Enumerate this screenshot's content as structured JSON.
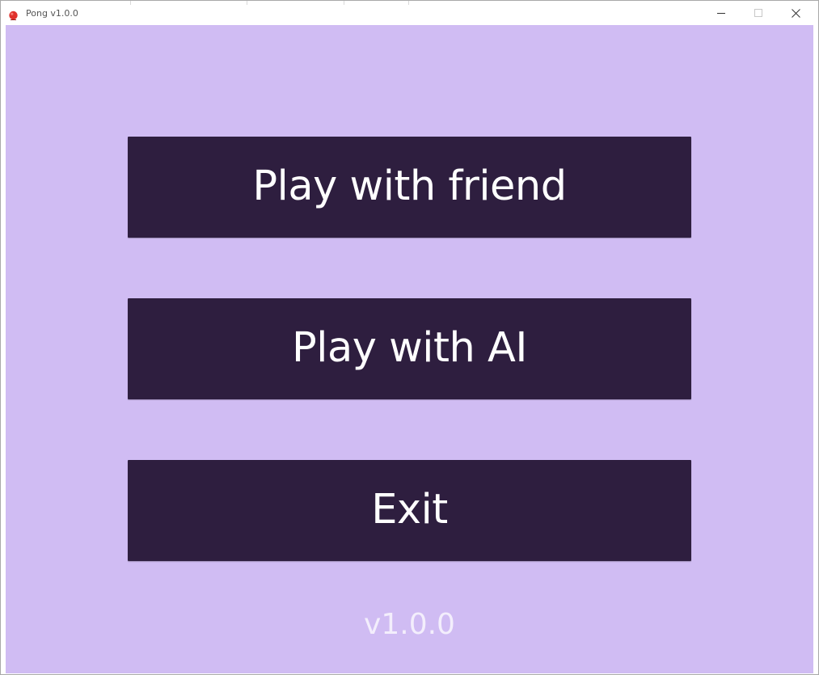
{
  "window": {
    "title": "Pong v1.0.0",
    "icon": "red-ball-icon",
    "controls": {
      "minimize_icon": "minimize-icon",
      "maximize_icon": "maximize-icon",
      "close_icon": "close-icon"
    }
  },
  "menu": {
    "play_friend_label": "Play with friend",
    "play_ai_label": "Play with AI",
    "exit_label": "Exit"
  },
  "footer": {
    "version": "v1.0.0"
  },
  "colors": {
    "background": "#d0bcf3",
    "button": "#2e1e3f",
    "button_text": "#ffffff",
    "version_text": "#f3eefc",
    "icon_red": "#e0312c"
  }
}
